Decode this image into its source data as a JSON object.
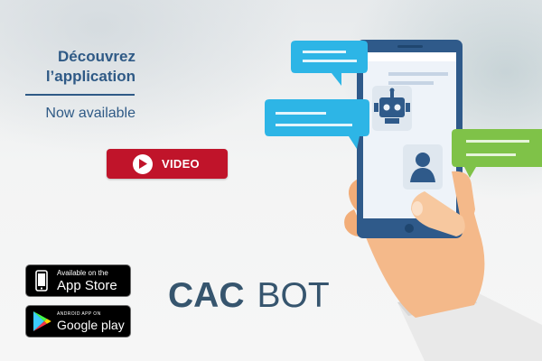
{
  "promo": {
    "headline_line1": "Découvrez",
    "headline_line2": "l’application",
    "subline": "Now available"
  },
  "video_button": {
    "label": "VIDEO",
    "icon": "play-icon"
  },
  "stores": {
    "appstore": {
      "small": "Available on the",
      "big": "App Store",
      "icon": "apple-icon"
    },
    "playstore": {
      "small": "ANDROID APP ON",
      "big": "Google play",
      "icon": "google-play-icon"
    }
  },
  "brand": {
    "part1": "CAC",
    "part2": "BOT"
  },
  "colors": {
    "accent_blue": "#2f5a86",
    "video_red": "#c0142a",
    "brand_text": "#36556e",
    "bubble_cyan": "#2db5e6",
    "bubble_green": "#7fc248",
    "phone_blue": "#2f5a8a"
  },
  "illustration": {
    "icons": [
      "chat-bubble-icon",
      "robot-icon",
      "user-icon",
      "hand-holding-phone"
    ]
  }
}
